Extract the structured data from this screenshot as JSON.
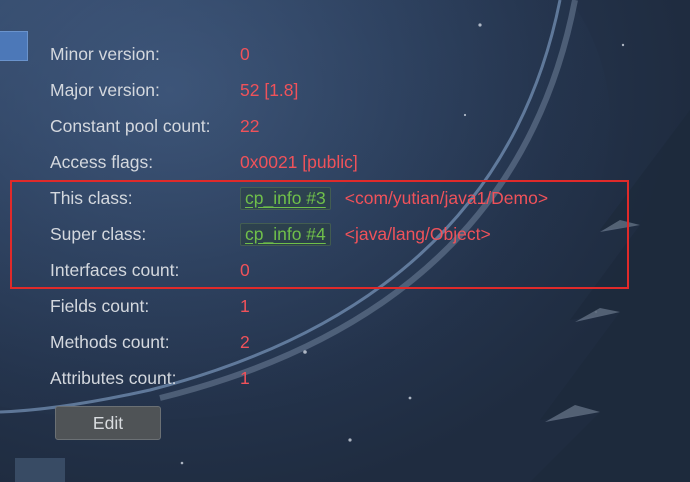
{
  "fields": [
    {
      "label": "Minor version:",
      "value": "0"
    },
    {
      "label": "Major version:",
      "value": "52 [1.8]"
    },
    {
      "label": "Constant pool count:",
      "value": "22"
    },
    {
      "label": "Access flags:",
      "value": "0x0021 [public]"
    }
  ],
  "this_class": {
    "label": "This class:",
    "link": "cp_info #3",
    "ref": "<com/yutian/java1/Demo>"
  },
  "super_class": {
    "label": "Super class:",
    "link": "cp_info #4",
    "ref": "<java/lang/Object>"
  },
  "interfaces": {
    "label": "Interfaces count:",
    "value": "0"
  },
  "counts": [
    {
      "label": "Fields count:",
      "value": "1"
    },
    {
      "label": "Methods count:",
      "value": "2"
    },
    {
      "label": "Attributes count:",
      "value": "1"
    }
  ],
  "edit_button": {
    "label": "Edit"
  },
  "colors": {
    "label": "#d4d8de",
    "value": "#f0525a",
    "link": "#6fbf4a",
    "highlight_box": "#e02a2a"
  }
}
